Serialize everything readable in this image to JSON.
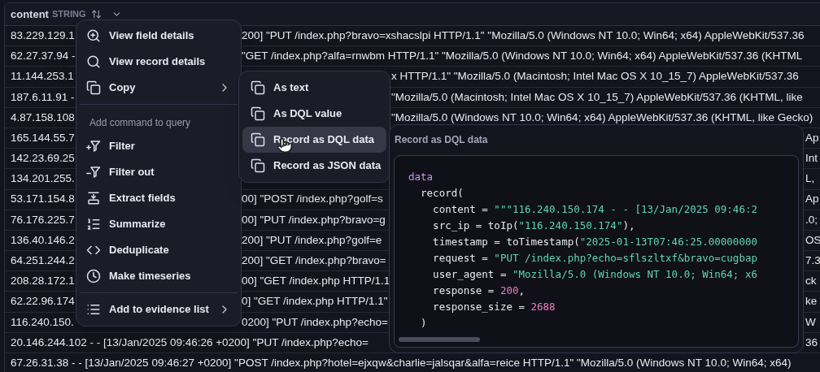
{
  "table": {
    "column": {
      "name": "content",
      "type": "STRING"
    },
    "rows": [
      {
        "kind": "menu",
        "pieces": [
          "83.229.129.1",
          "200] \"PUT /index.php?bravo=xshacslpi HTTP/1.1\" \"Mozilla/5.0 (Windows NT 10.0; Win64; x64) AppleWebKit/537.36"
        ]
      },
      {
        "kind": "menu",
        "pieces": [
          "62.27.37.94 -",
          "\"GET /index.php?alfa=rnwbm HTTP/1.1\" \"Mozilla/5.0 (Windows NT 10.0; Win64; x64) AppleWebKit/537.36 (KHTML"
        ]
      },
      {
        "kind": "submenu",
        "pieces": [
          "11.144.253.1",
          "x HTTP/1.1\" \"Mozilla/5.0 (Macintosh; Intel Mac OS X 10_15_7) AppleWebKit/537.36"
        ]
      },
      {
        "kind": "submenu",
        "pieces": [
          "187.6.11.91 -",
          "\"Mozilla/5.0 (Macintosh; Intel Mac OS X 10_15_7) AppleWebKit/537.36 (KHTML, like"
        ]
      },
      {
        "kind": "submenu",
        "pieces": [
          "4.87.158.108",
          "\"Mozilla/5.0 (Windows NT 10.0; Win64; x64) AppleWebKit/537.36 (KHTML, like Gecko)"
        ]
      },
      {
        "kind": "panel",
        "pieces": [
          "165.144.55.7",
          "Ap"
        ]
      },
      {
        "kind": "panel",
        "pieces": [
          "142.23.69.25",
          "Int"
        ]
      },
      {
        "kind": "panel",
        "pieces": [
          "134.201.255.",
          "L,"
        ]
      },
      {
        "kind": "split",
        "pieces": [
          "53.171.154.8",
          "00] \"POST /index.php?golf=s",
          "Ap"
        ]
      },
      {
        "kind": "split",
        "pieces": [
          "76.176.225.7",
          "00] \"PUT /index.php?bravo=g",
          ".0;"
        ]
      },
      {
        "kind": "split",
        "pieces": [
          "136.40.146.2",
          "200] \"PUT /index.php?golf=e",
          "OS"
        ]
      },
      {
        "kind": "split",
        "pieces": [
          "64.251.244.2",
          "200] \"GET /index.php?bravo=",
          "7.3"
        ]
      },
      {
        "kind": "split",
        "pieces": [
          "208.28.172.1",
          "00] \"GET /index.php HTTP/1.1",
          "ck"
        ]
      },
      {
        "kind": "split",
        "pieces": [
          "62.22.96.174",
          "0] \"GET /index.php HTTP/1.1\"",
          "ke"
        ]
      },
      {
        "kind": "split",
        "pieces": [
          "116.240.150.",
          "0200] \"PUT /index.php?echo=",
          "W"
        ]
      },
      {
        "kind": "panel",
        "pieces": [
          "20.146.244.102 - - [13/Jan/2025 09:46:26 +0200] \"PUT /index.php?echo=",
          "36"
        ]
      },
      {
        "kind": "full",
        "pieces": [
          "67.26.31.38 - - [13/Jan/2025 09:46:27 +0200] \"POST /index.php?hotel=ejxqw&charlie=jalsqar&alfa=reice HTTP/1.1\" \"Mozilla/5.0 (Windows NT 10.0; Win64; x64)"
        ]
      }
    ]
  },
  "context_menu": {
    "items": [
      {
        "kind": "item",
        "label": "View field details",
        "has_submenu": false
      },
      {
        "kind": "item",
        "label": "View record details",
        "has_submenu": false
      },
      {
        "kind": "item",
        "label": "Copy",
        "has_submenu": true
      },
      {
        "kind": "separator"
      },
      {
        "kind": "section",
        "label": "Add command to query"
      },
      {
        "kind": "item",
        "label": "Filter",
        "has_submenu": false
      },
      {
        "kind": "item",
        "label": "Filter out",
        "has_submenu": false
      },
      {
        "kind": "item",
        "label": "Extract fields",
        "has_submenu": false
      },
      {
        "kind": "item",
        "label": "Summarize",
        "has_submenu": false
      },
      {
        "kind": "item",
        "label": "Deduplicate",
        "has_submenu": false
      },
      {
        "kind": "item",
        "label": "Make timeseries",
        "has_submenu": false
      },
      {
        "kind": "separator"
      },
      {
        "kind": "item",
        "label": "Add to evidence list",
        "has_submenu": true
      }
    ]
  },
  "copy_submenu": {
    "items": [
      {
        "label": "As text",
        "selected": false
      },
      {
        "label": "As DQL value",
        "selected": false
      },
      {
        "label": "Record as DQL data",
        "selected": true
      },
      {
        "label": "Record as JSON data",
        "selected": false
      }
    ]
  },
  "preview": {
    "title": "Record as DQL data",
    "code": [
      [
        {
          "kind": "keyword",
          "text": "data"
        }
      ],
      [
        {
          "kind": "plain",
          "text": "  record("
        }
      ],
      [
        {
          "kind": "plain",
          "text": "    content = "
        },
        {
          "kind": "string",
          "text": "\"\"\"116.240.150.174 - - [13/Jan/2025 09:46:2"
        }
      ],
      [
        {
          "kind": "plain",
          "text": "    src_ip = toIp("
        },
        {
          "kind": "string",
          "text": "\"116.240.150.174\""
        },
        {
          "kind": "plain",
          "text": "),"
        }
      ],
      [
        {
          "kind": "plain",
          "text": "    timestamp = toTimestamp("
        },
        {
          "kind": "string",
          "text": "\"2025-01-13T07:46:25.00000000"
        }
      ],
      [
        {
          "kind": "plain",
          "text": "    request = "
        },
        {
          "kind": "string",
          "text": "\"PUT /index.php?echo=sflszltxf&bravo=cugbap"
        }
      ],
      [
        {
          "kind": "plain",
          "text": "    user_agent = "
        },
        {
          "kind": "string",
          "text": "\"Mozilla/5.0 (Windows NT 10.0; Win64; x6"
        }
      ],
      [
        {
          "kind": "plain",
          "text": "    response = "
        },
        {
          "kind": "number",
          "text": "200"
        },
        {
          "kind": "plain",
          "text": ","
        }
      ],
      [
        {
          "kind": "plain",
          "text": "    response_size = "
        },
        {
          "kind": "number",
          "text": "2688"
        }
      ],
      [
        {
          "kind": "plain",
          "text": "  )"
        }
      ]
    ]
  }
}
